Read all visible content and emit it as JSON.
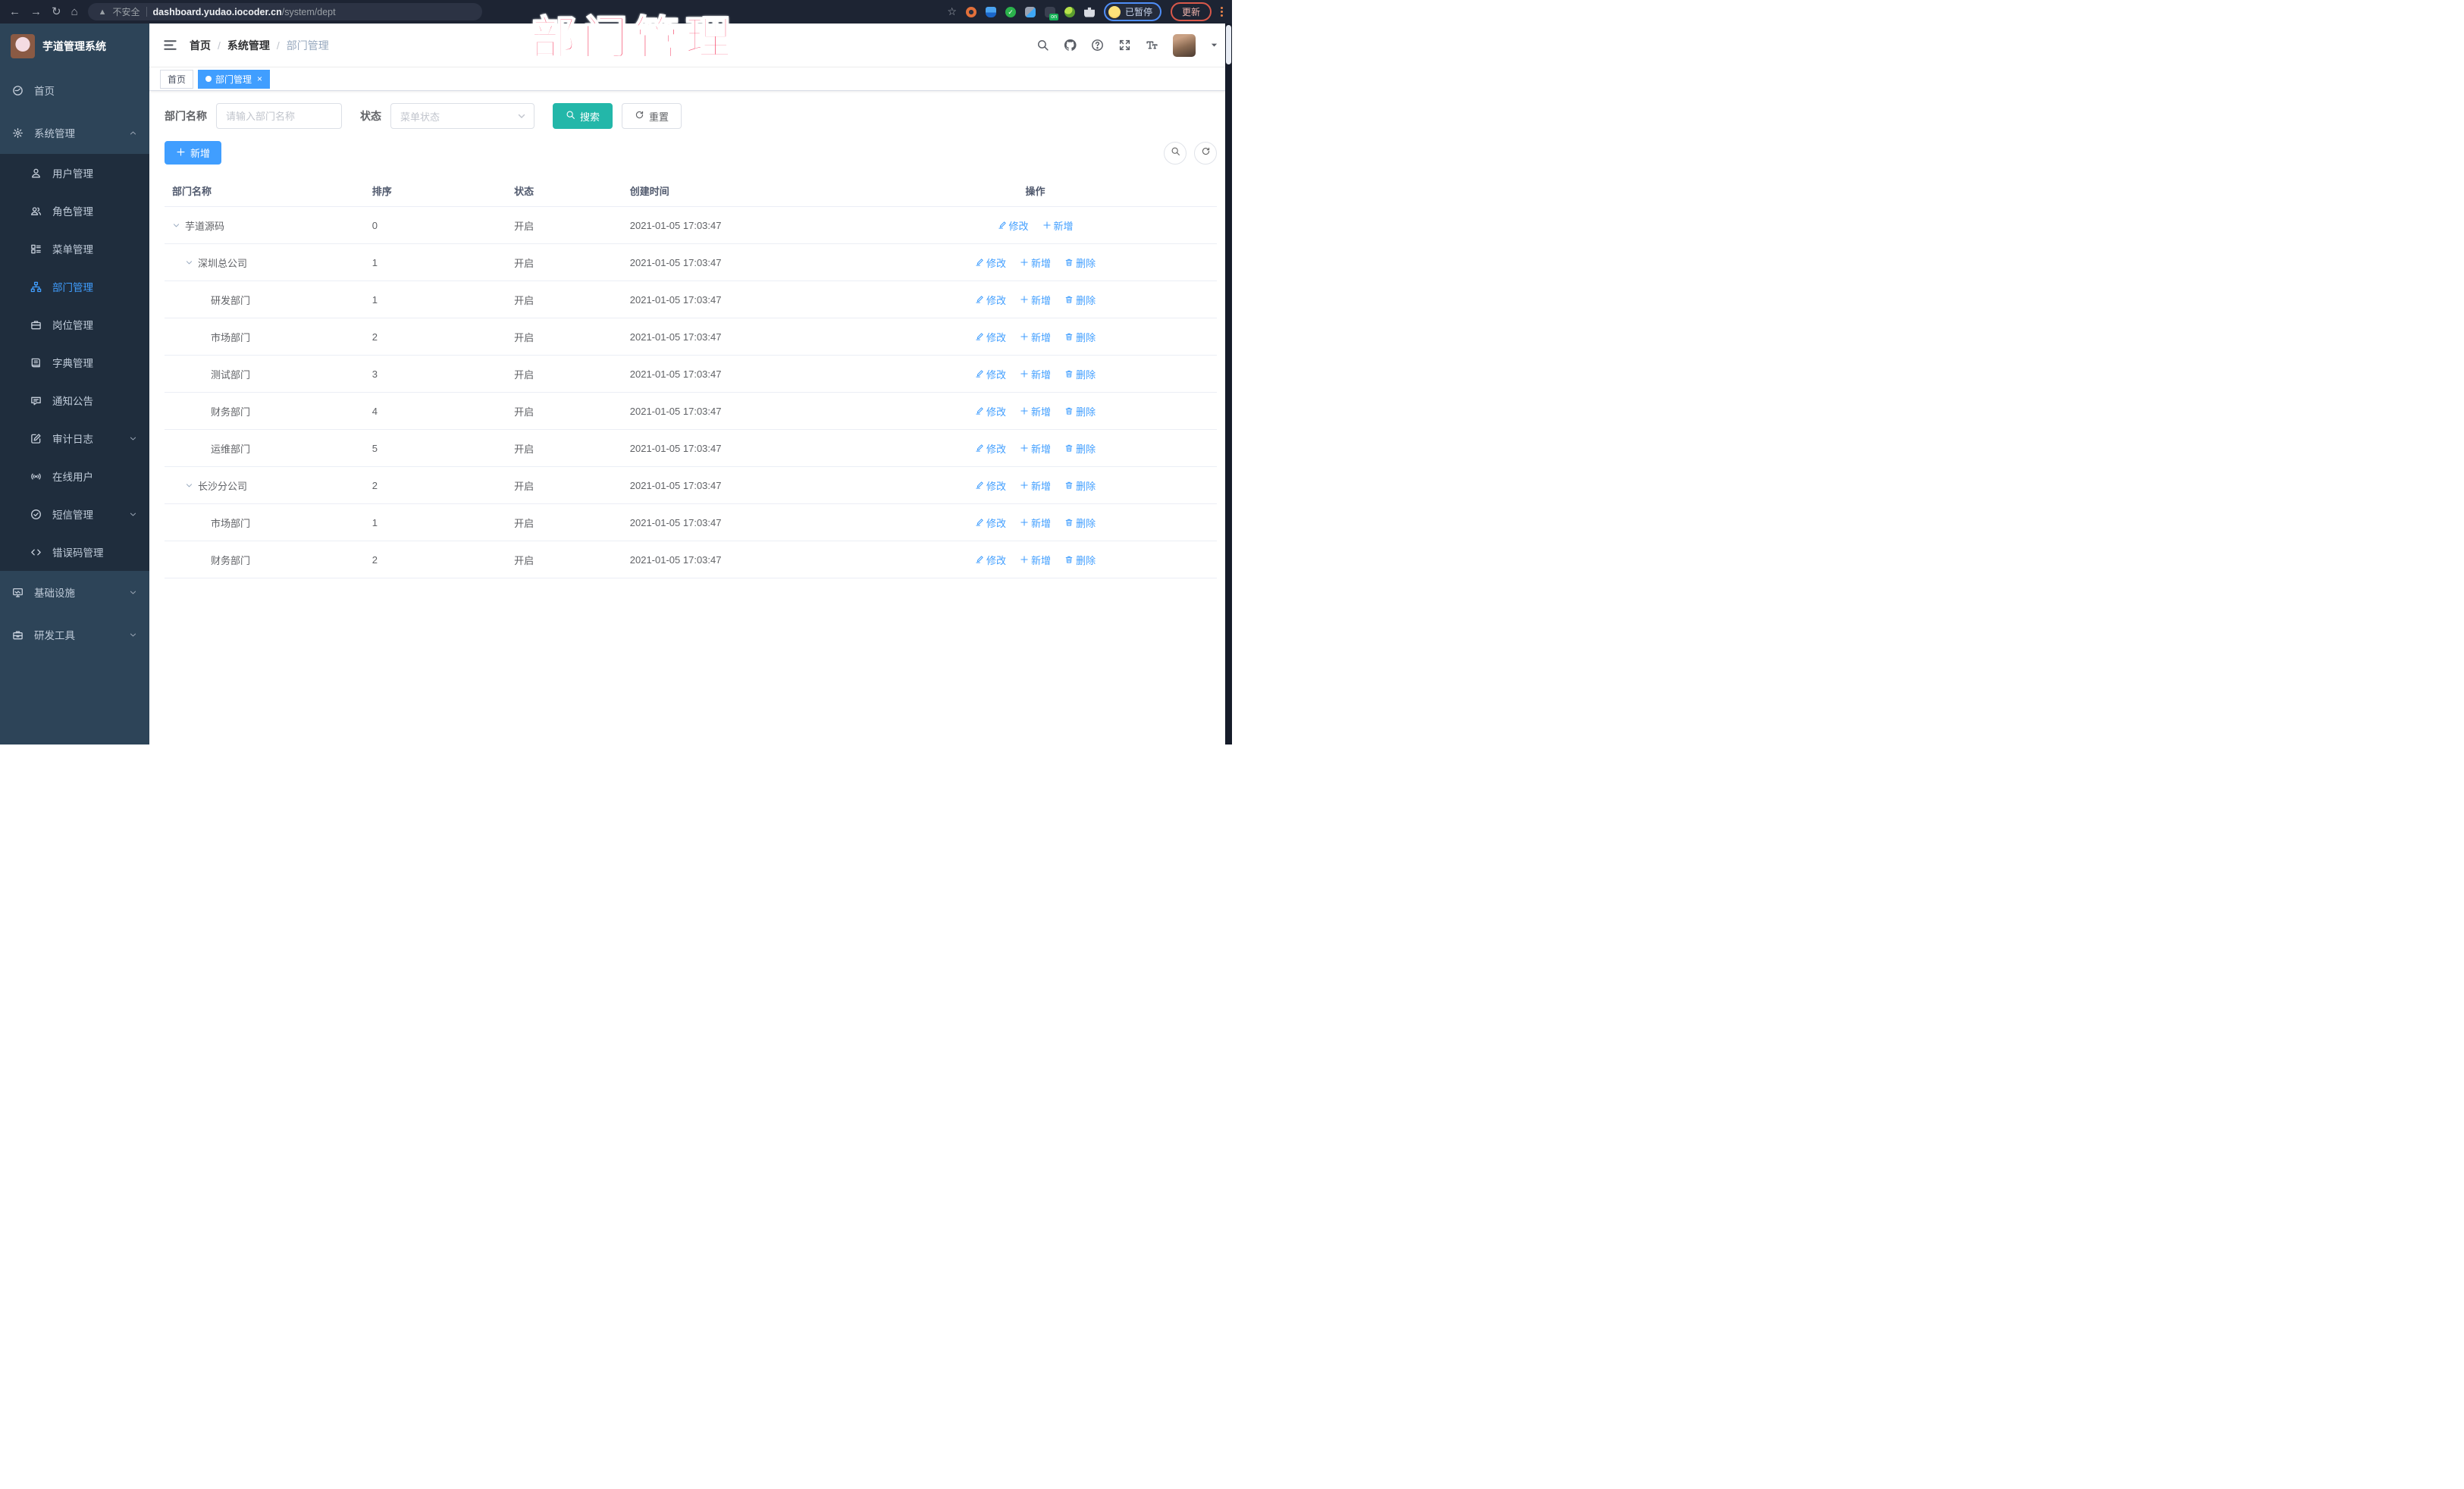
{
  "browser": {
    "not_secure_label": "不安全",
    "url_domain": "dashboard.yudao.iocoder.cn",
    "url_path": "/system/dept",
    "paused_label": "已暂停",
    "update_label": "更新"
  },
  "watermark_text": "部门管理",
  "sidebar": {
    "title": "芋道管理系统",
    "items": [
      {
        "label": "首页",
        "icon": "dashboard-icon",
        "level": 1
      },
      {
        "label": "系统管理",
        "icon": "gear-icon",
        "level": 1,
        "chevron": "up"
      },
      {
        "label": "用户管理",
        "icon": "user-icon",
        "level": 2
      },
      {
        "label": "角色管理",
        "icon": "users-icon",
        "level": 2
      },
      {
        "label": "菜单管理",
        "icon": "menu-list-icon",
        "level": 2
      },
      {
        "label": "部门管理",
        "icon": "org-tree-icon",
        "level": 2,
        "active": true
      },
      {
        "label": "岗位管理",
        "icon": "briefcase-icon",
        "level": 2
      },
      {
        "label": "字典管理",
        "icon": "book-icon",
        "level": 2
      },
      {
        "label": "通知公告",
        "icon": "announcement-icon",
        "level": 2
      },
      {
        "label": "审计日志",
        "icon": "edit-log-icon",
        "level": 2,
        "chevron": "down"
      },
      {
        "label": "在线用户",
        "icon": "online-icon",
        "level": 2
      },
      {
        "label": "短信管理",
        "icon": "sms-icon",
        "level": 2,
        "chevron": "down"
      },
      {
        "label": "错误码管理",
        "icon": "code-icon",
        "level": 2
      },
      {
        "label": "基础设施",
        "icon": "monitor-icon",
        "level": 1,
        "chevron": "down"
      },
      {
        "label": "研发工具",
        "icon": "toolbox-icon",
        "level": 1,
        "chevron": "down"
      }
    ]
  },
  "breadcrumb": {
    "items": [
      "首页",
      "系统管理",
      "部门管理"
    ]
  },
  "tabs": [
    {
      "label": "首页",
      "active": false
    },
    {
      "label": "部门管理",
      "active": true,
      "close": "×"
    }
  ],
  "search": {
    "name_label": "部门名称",
    "name_placeholder": "请输入部门名称",
    "status_label": "状态",
    "status_placeholder": "菜单状态",
    "search_label": "搜索",
    "reset_label": "重置"
  },
  "toolbar": {
    "add_label": "新增"
  },
  "table": {
    "headers": [
      "部门名称",
      "排序",
      "状态",
      "创建时间",
      "操作"
    ],
    "action_labels": {
      "edit": "修改",
      "add": "新增",
      "delete": "删除"
    },
    "rows": [
      {
        "name": "芋道源码",
        "level": 0,
        "expandable": true,
        "sort": "0",
        "status": "开启",
        "created": "2021-01-05 17:03:47",
        "actions": [
          "edit",
          "add"
        ]
      },
      {
        "name": "深圳总公司",
        "level": 1,
        "expandable": true,
        "sort": "1",
        "status": "开启",
        "created": "2021-01-05 17:03:47",
        "actions": [
          "edit",
          "add",
          "delete"
        ]
      },
      {
        "name": "研发部门",
        "level": 2,
        "expandable": false,
        "sort": "1",
        "status": "开启",
        "created": "2021-01-05 17:03:47",
        "actions": [
          "edit",
          "add",
          "delete"
        ]
      },
      {
        "name": "市场部门",
        "level": 2,
        "expandable": false,
        "sort": "2",
        "status": "开启",
        "created": "2021-01-05 17:03:47",
        "actions": [
          "edit",
          "add",
          "delete"
        ]
      },
      {
        "name": "测试部门",
        "level": 2,
        "expandable": false,
        "sort": "3",
        "status": "开启",
        "created": "2021-01-05 17:03:47",
        "actions": [
          "edit",
          "add",
          "delete"
        ]
      },
      {
        "name": "财务部门",
        "level": 2,
        "expandable": false,
        "sort": "4",
        "status": "开启",
        "created": "2021-01-05 17:03:47",
        "actions": [
          "edit",
          "add",
          "delete"
        ]
      },
      {
        "name": "运维部门",
        "level": 2,
        "expandable": false,
        "sort": "5",
        "status": "开启",
        "created": "2021-01-05 17:03:47",
        "actions": [
          "edit",
          "add",
          "delete"
        ]
      },
      {
        "name": "长沙分公司",
        "level": 1,
        "expandable": true,
        "sort": "2",
        "status": "开启",
        "created": "2021-01-05 17:03:47",
        "actions": [
          "edit",
          "add",
          "delete"
        ]
      },
      {
        "name": "市场部门",
        "level": 2,
        "expandable": false,
        "sort": "1",
        "status": "开启",
        "created": "2021-01-05 17:03:47",
        "actions": [
          "edit",
          "add",
          "delete"
        ]
      },
      {
        "name": "财务部门",
        "level": 2,
        "expandable": false,
        "sort": "2",
        "status": "开启",
        "created": "2021-01-05 17:03:47",
        "actions": [
          "edit",
          "add",
          "delete"
        ]
      }
    ]
  },
  "colors": {
    "accent": "#409EFF",
    "search_button": "#23B7A9",
    "watermark": "#F5365C",
    "sidebar_bg": "#2D4458",
    "submenu_bg": "#1F2D3D"
  }
}
